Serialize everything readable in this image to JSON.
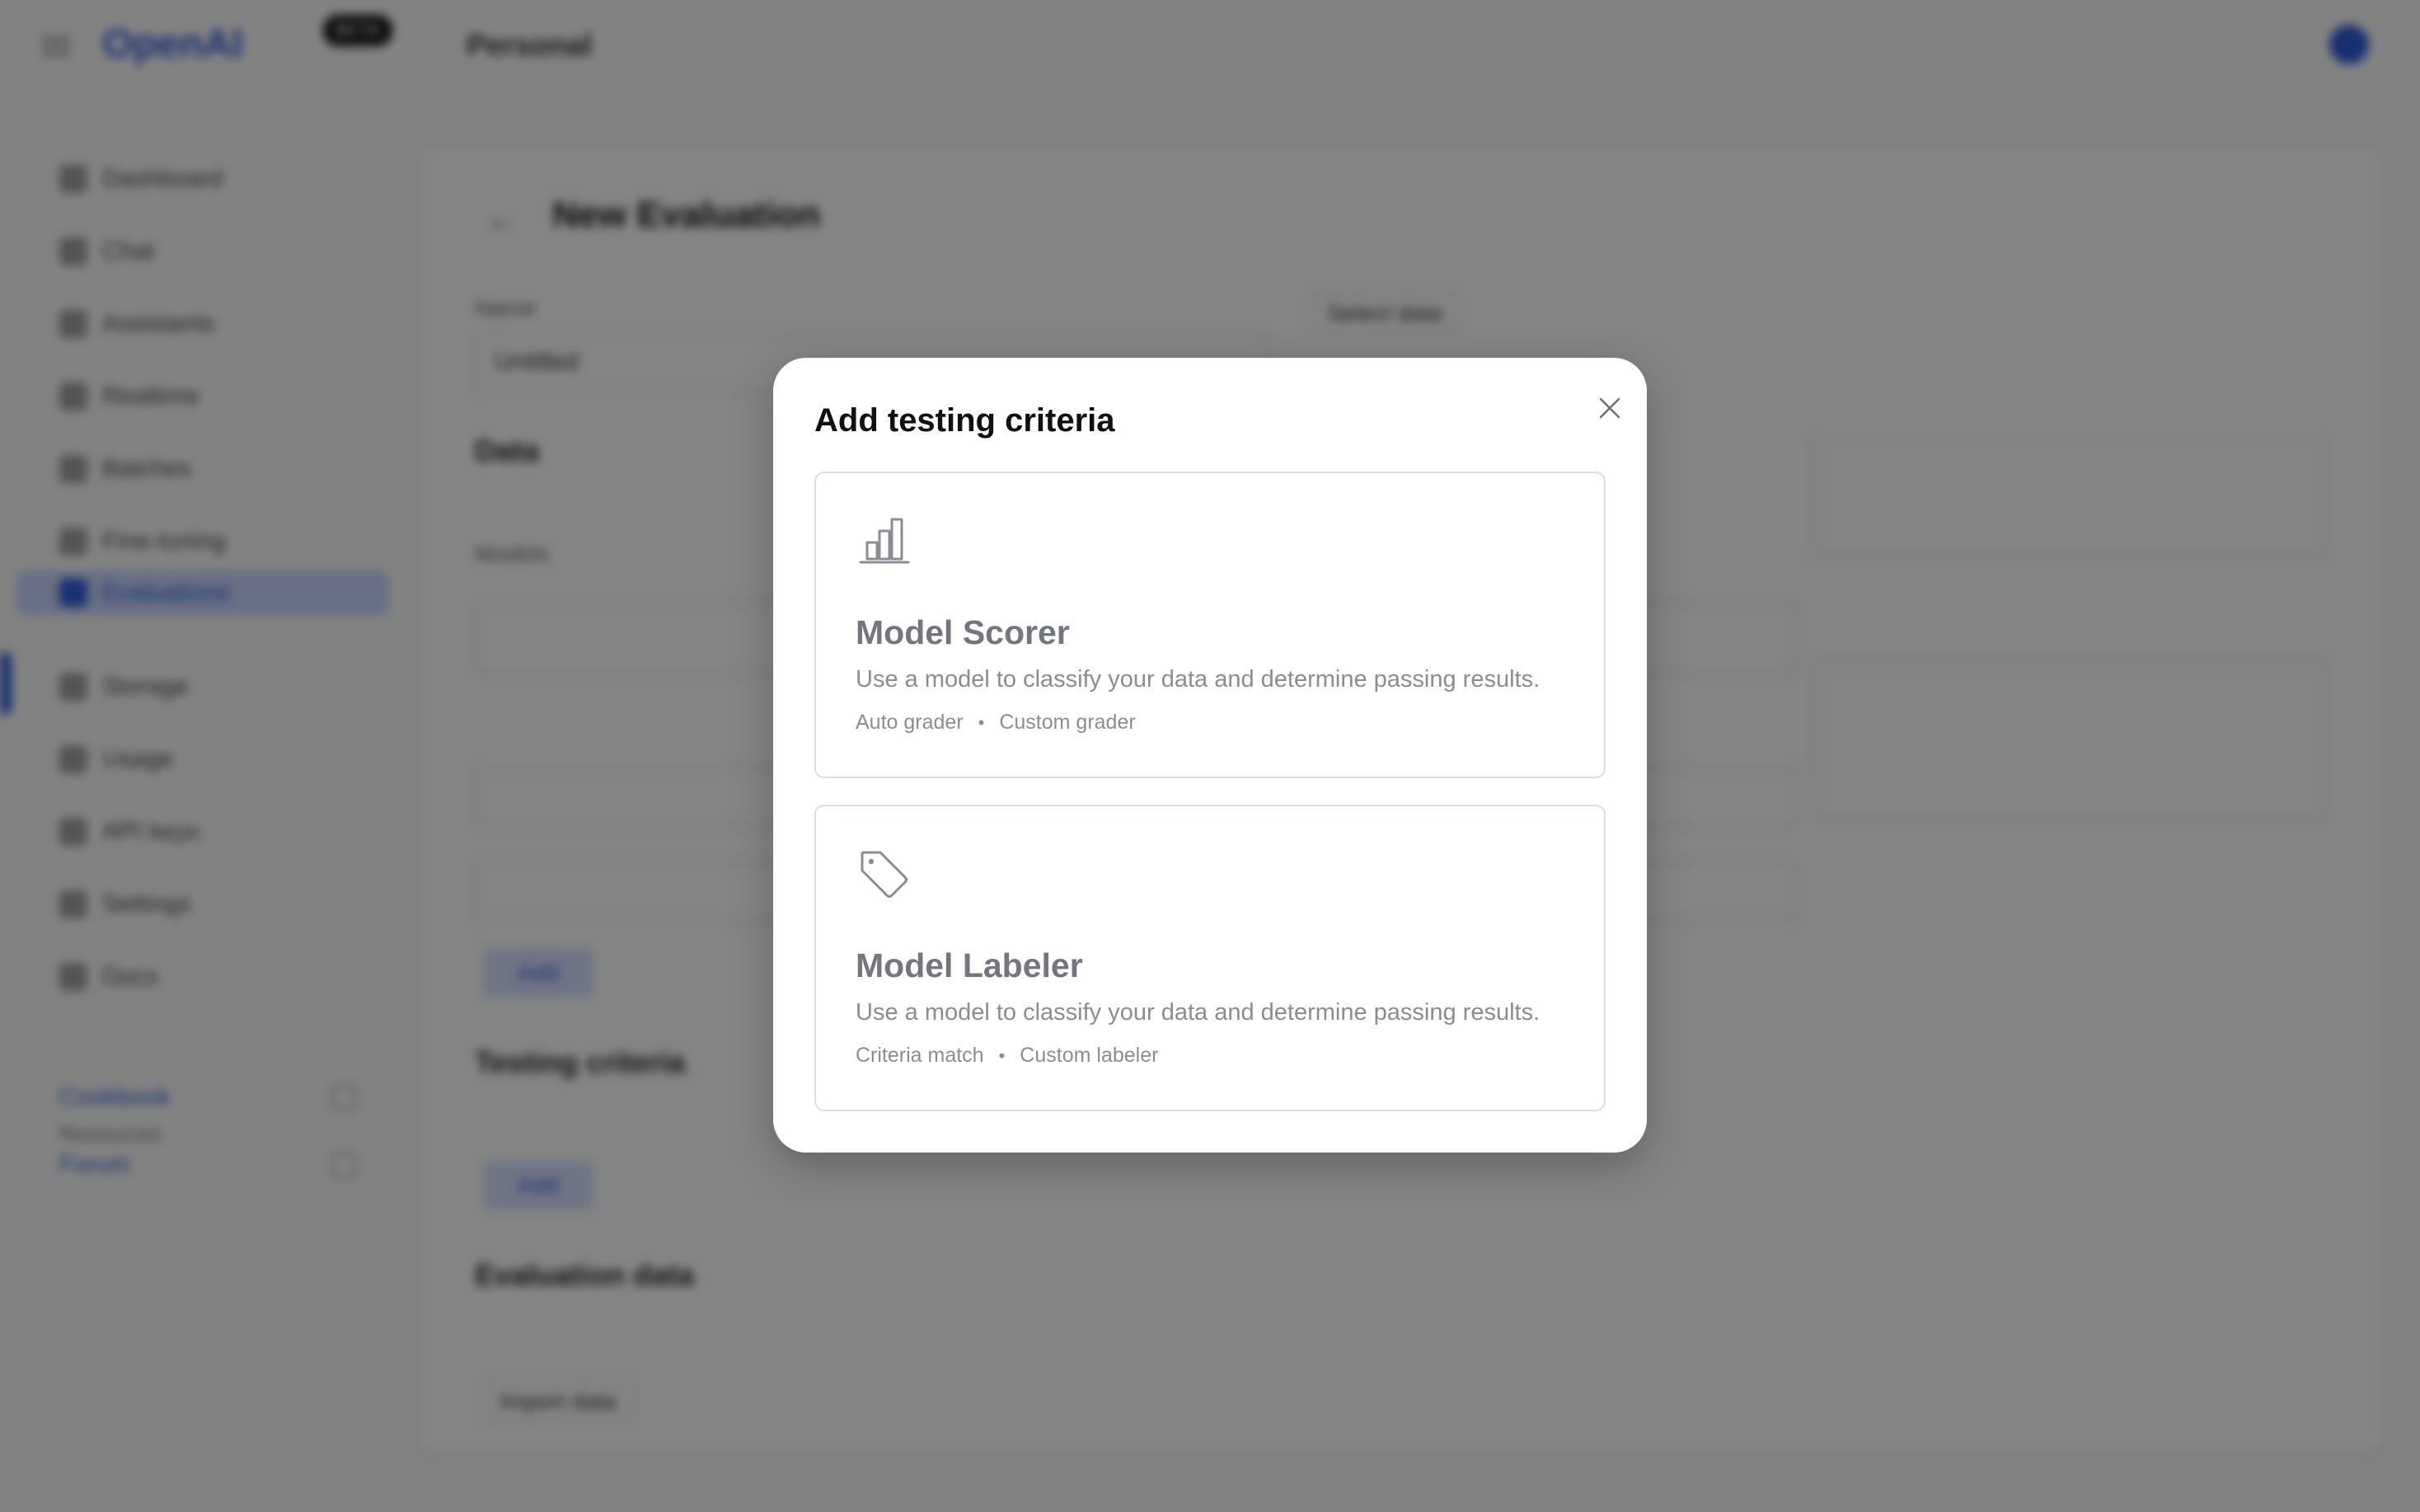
{
  "background": {
    "brand": "OpenAI",
    "badge": "BETA",
    "org": "Personal",
    "sidebar": {
      "items": [
        "Dashboard",
        "Chat",
        "Assistants",
        "Realtime",
        "Batches",
        "Fine-tuning",
        "Evaluations",
        "Storage",
        "Usage",
        "API keys",
        "Settings",
        "Docs"
      ],
      "section_label": "Resources",
      "links": [
        "Cookbook",
        "Forum"
      ]
    },
    "page": {
      "title": "New Evaluation",
      "name_label": "Name",
      "name_value": "Untitled",
      "data_label": "Data",
      "data_text": "Select data",
      "models_label": "Models",
      "criteria_label": "Testing criteria",
      "add_label": "Add",
      "eval_label": "Evaluation data",
      "import_label": "Import data"
    }
  },
  "modal": {
    "title": "Add testing criteria",
    "options": [
      {
        "icon": "bar-chart-icon",
        "title": "Model Scorer",
        "description": "Use a model to classify your data and determine passing results.",
        "tags": [
          "Auto grader",
          "Custom grader"
        ]
      },
      {
        "icon": "tag-icon",
        "title": "Model Labeler",
        "description": "Use a model to classify your data and determine passing results.",
        "tags": [
          "Criteria match",
          "Custom labeler"
        ]
      }
    ]
  }
}
